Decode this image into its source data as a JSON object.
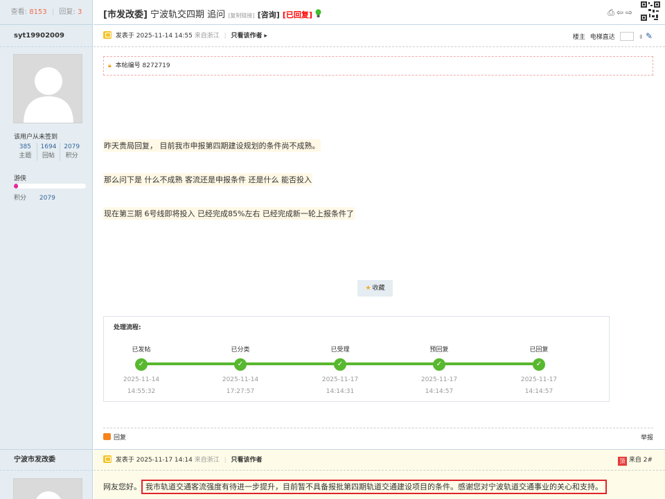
{
  "header": {
    "views_label": "查看:",
    "views": "8153",
    "replies_label": "回复:",
    "replies": "3",
    "title_category": "[市发改委]",
    "title_text": "宁波轨交四期 追问",
    "copy_link": "[复制链接]",
    "tag_consult": "[咨询]",
    "tag_replied": "[已回复]"
  },
  "author": {
    "name": "syt19902009",
    "sign_note": "该用户从未签到",
    "stats": [
      {
        "value": "385",
        "label": "主题"
      },
      {
        "value": "1694",
        "label": "回帖"
      },
      {
        "value": "2079",
        "label": "积分"
      }
    ],
    "rank": "游侠",
    "rank_progress": 0.06,
    "points_label": "积分",
    "points": "2079"
  },
  "post1": {
    "posted_label": "发表于 2025-11-14 14:55",
    "from": "来自浙江",
    "only_author": "只看该作者",
    "floor_label": "楼主",
    "jump_label": "电梯直达",
    "post_id_label": "本帖编号 8272719",
    "lines": [
      "昨天贵局回复， 目前我市申报第四期建设规划的条件尚不成熟。",
      "那么问下是 什么不成熟 客流还是申报条件  还是什么 能否投入",
      "现在第三期  6号线即将投入 已经完成85%左右 已经完成新一轮上报条件了"
    ],
    "favorite": "收藏",
    "process_title": "处理流程:",
    "steps": [
      {
        "name": "已发帖",
        "date": "2025-11-14",
        "time": "14:55:32"
      },
      {
        "name": "已分类",
        "date": "2025-11-14",
        "time": "17:27:57"
      },
      {
        "name": "已受理",
        "date": "2025-11-17",
        "time": "14:14:31"
      },
      {
        "name": "预回复",
        "date": "2025-11-17",
        "time": "14:14:57"
      },
      {
        "name": "已回复",
        "date": "2025-11-17",
        "time": "14:14:57"
      }
    ],
    "reply": "回复",
    "report": "举报"
  },
  "author2": {
    "name": "宁波市发改委"
  },
  "post2": {
    "posted_label": "发表于 2025-11-17 14:14",
    "from": "来自浙江",
    "only_author": "只看该作者",
    "top_badge": "顶",
    "floor": "来自 2#",
    "greeting": "网友您好。",
    "reply_boxed": "我市轨道交通客流强度有待进一步提升，目前暂不具备报批第四期轨道交通建设项目的条件。感谢您对宁波轨道交通事业的关心和支持。"
  },
  "colors": {
    "sidebar_bg": "#E5EDF2",
    "border": "#C2D5E3",
    "accent_green": "#58B82F",
    "alert_red": "#E0232B",
    "link_blue": "#336699",
    "rank_pink": "#E9259D"
  }
}
